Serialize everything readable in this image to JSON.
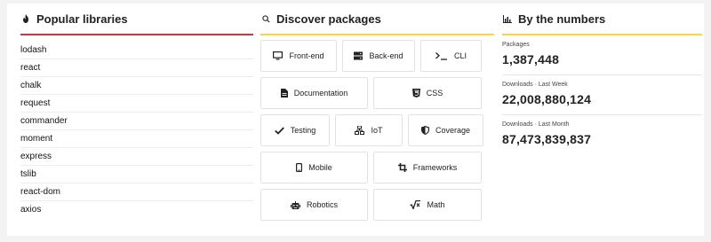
{
  "popular": {
    "title": "Popular libraries",
    "icon": "flame-icon",
    "items": [
      "lodash",
      "react",
      "chalk",
      "request",
      "commander",
      "moment",
      "express",
      "tslib",
      "react-dom",
      "axios"
    ]
  },
  "discover": {
    "title": "Discover packages",
    "icon": "search-icon",
    "rows": [
      [
        {
          "label": "Front-end",
          "icon": "monitor-icon"
        },
        {
          "label": "Back-end",
          "icon": "server-icon"
        },
        {
          "label": "CLI",
          "icon": "terminal-icon"
        }
      ],
      [
        {
          "label": "Documentation",
          "icon": "document-icon"
        },
        {
          "label": "CSS",
          "icon": "css-icon"
        }
      ],
      [
        {
          "label": "Testing",
          "icon": "check-icon"
        },
        {
          "label": "IoT",
          "icon": "network-icon"
        },
        {
          "label": "Coverage",
          "icon": "shield-icon"
        }
      ],
      [
        {
          "label": "Mobile",
          "icon": "mobile-icon"
        },
        {
          "label": "Frameworks",
          "icon": "crop-icon"
        }
      ],
      [
        {
          "label": "Robotics",
          "icon": "robot-icon"
        },
        {
          "label": "Math",
          "icon": "sqrt-icon"
        }
      ]
    ]
  },
  "numbers": {
    "title": "By the numbers",
    "icon": "bar-chart-icon",
    "stats": [
      {
        "label": "Packages",
        "value": "1,387,448"
      },
      {
        "label": "Downloads · Last Week",
        "value": "22,008,880,124"
      },
      {
        "label": "Downloads · Last Month",
        "value": "87,473,839,837"
      }
    ]
  },
  "colors": {
    "red_rule": "#cb3837",
    "yellow_rule": "#ffd43b"
  }
}
